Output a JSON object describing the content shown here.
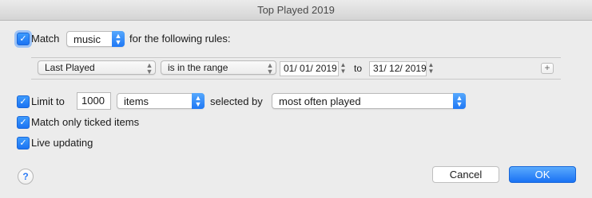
{
  "window": {
    "title": "Top Played 2019"
  },
  "match": {
    "checked": true,
    "label": "Match",
    "mode": "music",
    "suffix": "for the following rules:"
  },
  "rule": {
    "field": "Last Played",
    "operator": "is in the range",
    "from_date": "01/ 01/ 2019",
    "to_label": "to",
    "to_date": "31/ 12/ 2019",
    "add_label": "+"
  },
  "limit": {
    "checked": true,
    "label": "Limit to",
    "value": "1000",
    "unit": "items",
    "selected_by_label": "selected by",
    "selected_by": "most often played"
  },
  "match_ticked": {
    "checked": true,
    "label": "Match only ticked items"
  },
  "live_updating": {
    "checked": true,
    "label": "Live updating"
  },
  "footer": {
    "help": "?",
    "cancel": "Cancel",
    "ok": "OK"
  },
  "colors": {
    "accent": "#1f78f5",
    "window_bg": "#ececec"
  },
  "icons": {
    "checkbox": "checkmark-icon",
    "popup": "updown-chevron-icon",
    "help": "question-icon"
  }
}
